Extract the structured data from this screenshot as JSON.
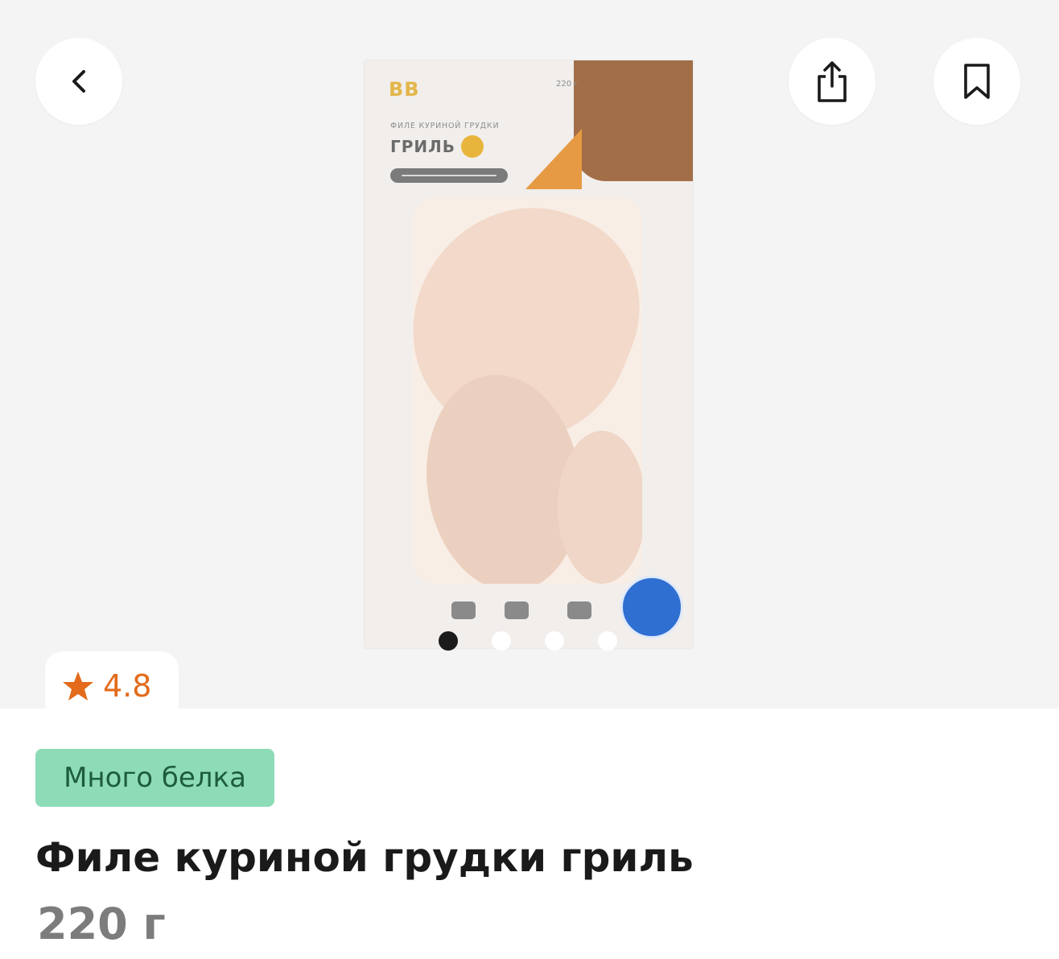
{
  "header": {
    "back_icon": "chevron-left-icon",
    "share_icon": "share-icon",
    "bookmark_icon": "bookmark-icon"
  },
  "product_image": {
    "package_brand": "BB",
    "package_weight": "220 г",
    "package_subtitle": "ФИЛЕ КУРИНОЙ ГРУДКИ",
    "package_title": "ГРИЛЬ"
  },
  "carousel": {
    "total": 4,
    "active_index": 0
  },
  "rating": {
    "icon": "star-icon",
    "value": "4.8",
    "color": "#e36b1b"
  },
  "product": {
    "tag": "Много белка",
    "title": "Филе куриной грудки гриль",
    "weight": "220 г"
  },
  "colors": {
    "tag_bg": "#8ddcb7",
    "tag_text": "#1d5c3c",
    "hero_bg": "#f4f4f4"
  }
}
